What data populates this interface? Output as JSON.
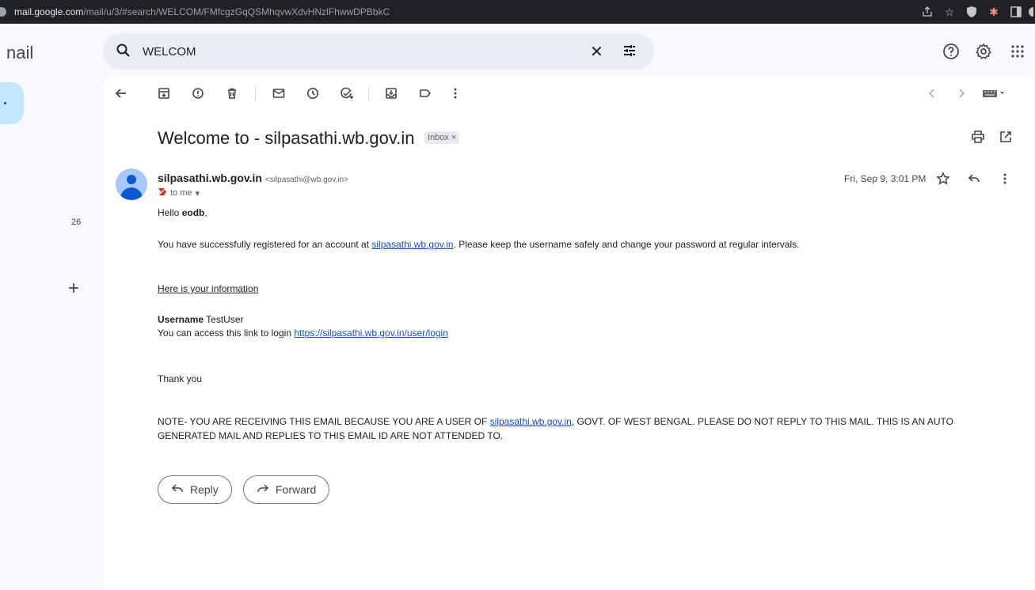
{
  "browser": {
    "url_host": "mail.google.com",
    "url_path": "/mail/u/3/#search/WELCOM/FMfcgzGqQSMhqvwXdvHNzlFhwwDPBbkC"
  },
  "app": {
    "logo_text": "nail"
  },
  "search": {
    "value": "WELCOM"
  },
  "sidebar": {
    "count": "26"
  },
  "message": {
    "subject": "Welcome to - silpasathi.wb.gov.in",
    "label_chip": "Inbox ×",
    "sender_name": "silpasathi.wb.gov.in",
    "sender_email": "<silpasathi@wb.gov.in>",
    "recipient": "to me",
    "date": "Fri, Sep 9, 3:01 PM",
    "greeting_prefix": "Hello ",
    "greeting_name": "eodb",
    "greeting_suffix": ",",
    "line1_pre": "You have successfully registered for an account at ",
    "line1_link": "silpasathi.wb.gov.in",
    "line1_post": ". Please keep the username safely and change your password at regular intervals.",
    "info_heading": "Here is your information",
    "username_label": "Username",
    "username_value": " TestUser",
    "login_pre": "You can access this link to login ",
    "login_link": "https://silpasathi.wb.gov.in/user/login",
    "thanks": "Thank you",
    "note_pre": "NOTE- YOU ARE RECEIVING THIS EMAIL BECAUSE YOU ARE A USER OF ",
    "note_link": "silpasathi.wb.gov.in",
    "note_post": ", GOVT. OF WEST BENGAL. PLEASE DO NOT REPLY TO THIS MAIL. THIS IS AN AUTO GENERATED MAIL AND REPLIES TO THIS EMAIL ID ARE NOT ATTENDED TO."
  },
  "actions": {
    "reply": "Reply",
    "forward": "Forward"
  },
  "icons": {
    "toolbar": [
      "back-icon",
      "archive-icon",
      "report-spam-icon",
      "delete-icon",
      "mark-unread-icon",
      "snooze-icon",
      "add-task-icon",
      "move-to-icon",
      "label-icon",
      "more-icon"
    ],
    "pager": [
      "prev-icon",
      "next-icon",
      "input-tools-icon"
    ],
    "top_right": [
      "help-icon",
      "settings-icon",
      "apps-icon"
    ]
  },
  "colors": {
    "accent": "#0b57d0",
    "search_bg": "#e9eef6",
    "compose": "#c2e7ff",
    "link": "#1a4fb5"
  }
}
